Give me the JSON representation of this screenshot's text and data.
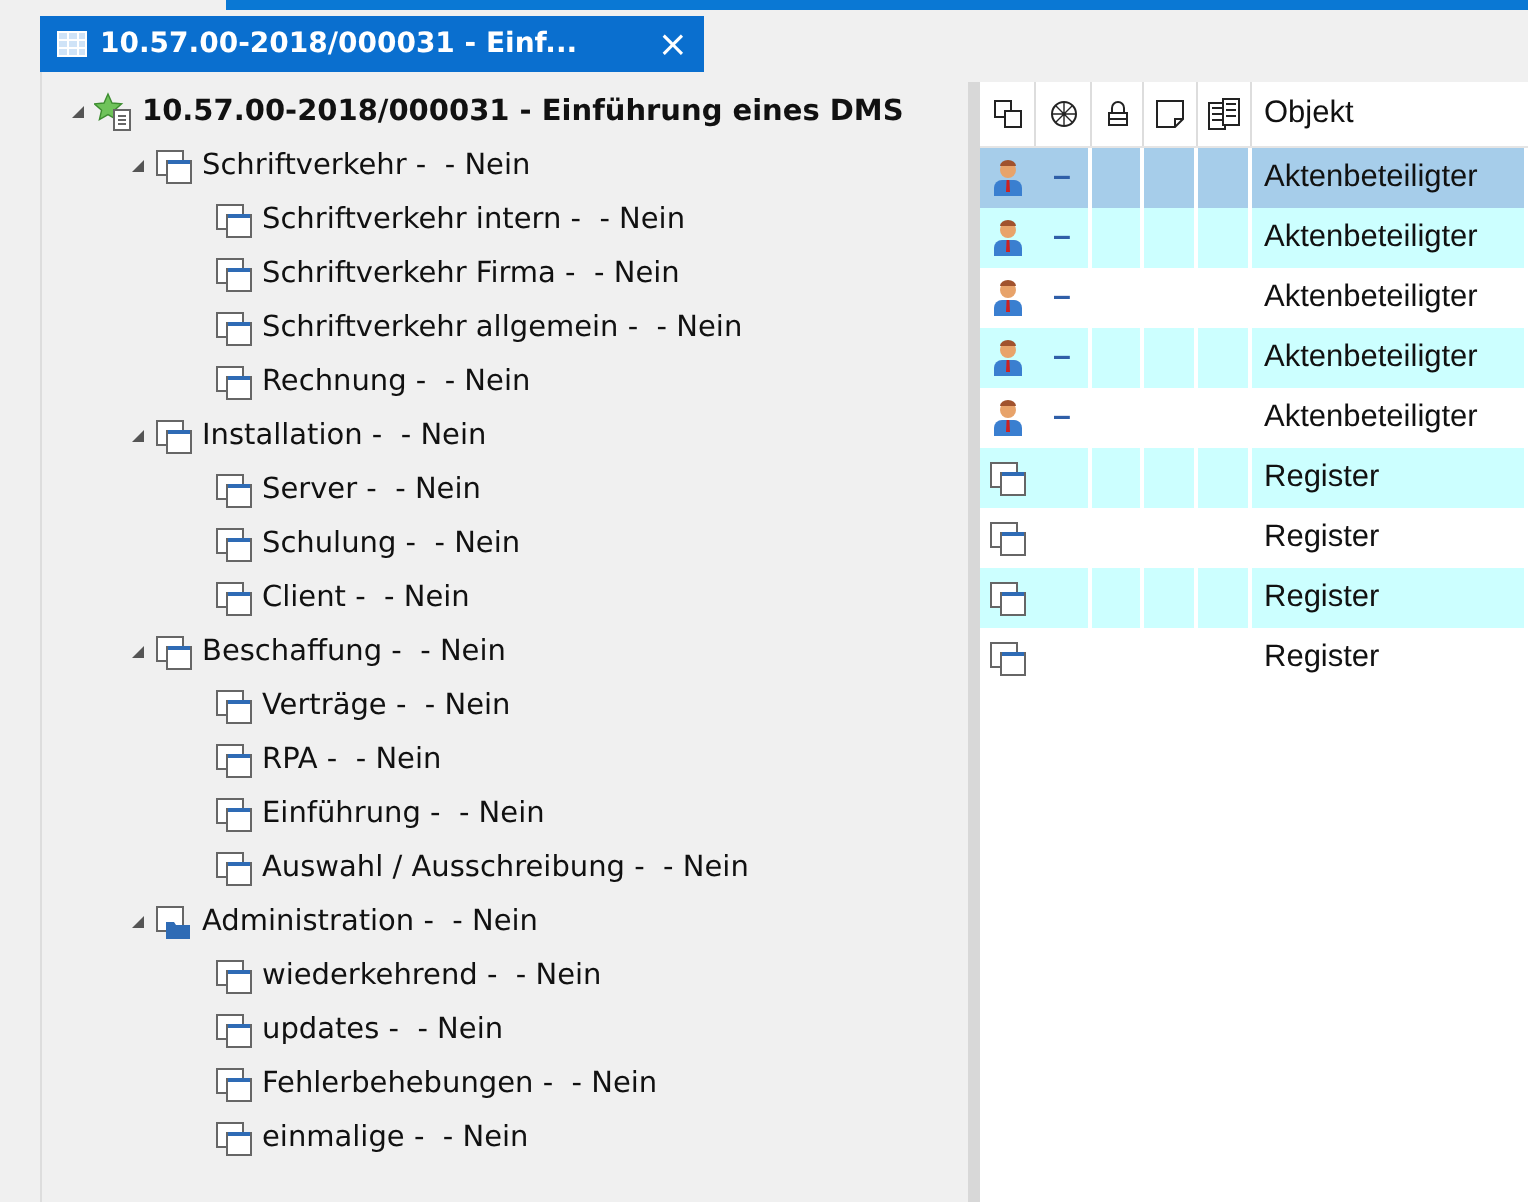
{
  "tab": {
    "title": "10.57.00-2018/000031 - Einf...",
    "close": "×"
  },
  "tree": [
    {
      "kind": "case",
      "label": "10.57.00-2018/000031 - Einführung eines DMS",
      "expanded": true,
      "children": [
        {
          "kind": "register",
          "label": "Schriftverkehr -  - Nein",
          "expanded": true,
          "children": [
            {
              "kind": "register",
              "label": "Schriftverkehr intern -  - Nein"
            },
            {
              "kind": "register",
              "label": "Schriftverkehr Firma -  - Nein"
            },
            {
              "kind": "register",
              "label": "Schriftverkehr allgemein -  - Nein"
            },
            {
              "kind": "register",
              "label": "Rechnung -  - Nein"
            }
          ]
        },
        {
          "kind": "register",
          "label": "Installation -  - Nein",
          "expanded": true,
          "children": [
            {
              "kind": "register",
              "label": "Server -  - Nein"
            },
            {
              "kind": "register",
              "label": "Schulung -  - Nein"
            },
            {
              "kind": "register",
              "label": "Client -  - Nein"
            }
          ]
        },
        {
          "kind": "register",
          "label": "Beschaffung -  - Nein",
          "expanded": true,
          "children": [
            {
              "kind": "register",
              "label": "Verträge -  - Nein"
            },
            {
              "kind": "register",
              "label": "RPA -  - Nein"
            },
            {
              "kind": "register",
              "label": "Einführung -  - Nein"
            },
            {
              "kind": "register",
              "label": "Auswahl / Ausschreibung -  - Nein"
            }
          ]
        },
        {
          "kind": "folder",
          "label": "Administration -  - Nein",
          "expanded": true,
          "children": [
            {
              "kind": "register",
              "label": "wiederkehrend -  - Nein"
            },
            {
              "kind": "register",
              "label": "updates -  - Nein"
            },
            {
              "kind": "register",
              "label": "Fehlerbehebungen -  - Nein"
            },
            {
              "kind": "register",
              "label": "einmalige -  - Nein"
            }
          ]
        }
      ]
    }
  ],
  "table": {
    "columns": [
      "Objekt"
    ],
    "rows": [
      {
        "kind": "person",
        "mark": "–",
        "object": "Aktenbeteiligter",
        "selected": true
      },
      {
        "kind": "person",
        "mark": "–",
        "object": "Aktenbeteiligter",
        "selected": false
      },
      {
        "kind": "person",
        "mark": "–",
        "object": "Aktenbeteiligter",
        "selected": false
      },
      {
        "kind": "person",
        "mark": "–",
        "object": "Aktenbeteiligter",
        "selected": false
      },
      {
        "kind": "person",
        "mark": "–",
        "object": "Aktenbeteiligter",
        "selected": false
      },
      {
        "kind": "register",
        "object": "Register",
        "selected": false
      },
      {
        "kind": "register",
        "object": "Register",
        "selected": false
      },
      {
        "kind": "register",
        "object": "Register",
        "selected": false
      },
      {
        "kind": "register",
        "object": "Register",
        "selected": false
      }
    ]
  }
}
